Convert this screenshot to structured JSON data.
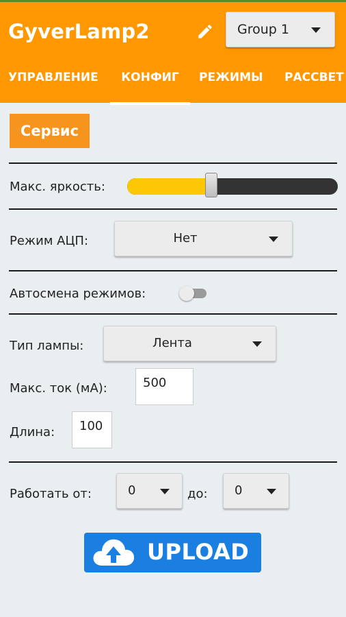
{
  "header": {
    "title": "GyverLamp2",
    "group_select": "Group 1"
  },
  "tabs": [
    {
      "label": "УПРАВЛЕНИЕ",
      "active": false
    },
    {
      "label": "КОНФИГ",
      "active": true
    },
    {
      "label": "РЕЖИМЫ",
      "active": false
    },
    {
      "label": "РАССВЕТ",
      "active": false
    }
  ],
  "service_button": "Сервис",
  "brightness": {
    "label": "Макс. яркость:",
    "value_fraction": 0.4
  },
  "adc_mode": {
    "label": "Режим АЦП:",
    "value": "Нет"
  },
  "auto_change": {
    "label": "Автосмена режимов:",
    "on": false
  },
  "lamp_type": {
    "label": "Тип лампы:",
    "value": "Лента"
  },
  "max_current": {
    "label": "Макс. ток (мА):",
    "value": "500"
  },
  "length": {
    "label": "Длина:",
    "value": "100"
  },
  "work_time": {
    "label_from": "Работать от:",
    "from_value": "0",
    "label_to": "до:",
    "to_value": "0"
  },
  "upload_button": "UPLOAD",
  "colors": {
    "header": "#ff9800",
    "service": "#f7941d",
    "slider_fill": "#fdc706",
    "upload": "#1a7fe0"
  }
}
